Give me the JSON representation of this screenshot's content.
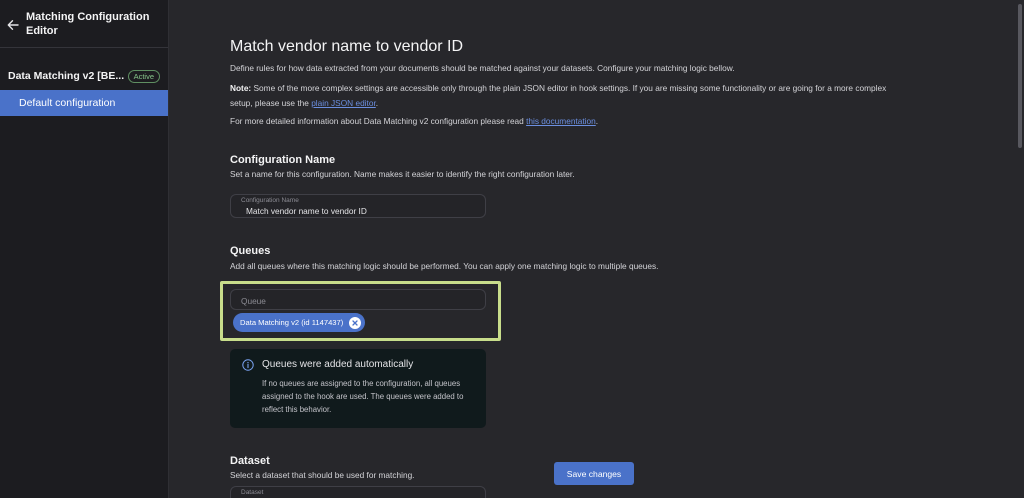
{
  "sidebar": {
    "title": "Matching Configuration Editor",
    "group_name": "Data Matching v2 [BE...",
    "badge": "Active",
    "items": [
      {
        "label": "Default configuration"
      }
    ]
  },
  "main": {
    "title": "Match vendor name to vendor ID",
    "intro": "Define rules for how data extracted from your documents should be matched against your datasets. Configure your matching logic bellow.",
    "note_label": "Note:",
    "note_text_line1": "Some of the more complex settings are accessible only through the plain JSON editor in hook settings. If you are missing some functionality or are going for a more complex",
    "note_text_line2_pre": "setup, please use the ",
    "note_link": "plain JSON editor",
    "note_text_line2_post": ".",
    "doc_pre": "For more detailed information about Data Matching v2 configuration please read ",
    "doc_link": "this documentation",
    "doc_post": "."
  },
  "config_name": {
    "title": "Configuration Name",
    "desc": "Set a name for this configuration. Name makes it easier to identify the right configuration later.",
    "field_label": "Configuration Name",
    "field_value": "Match vendor name to vendor ID"
  },
  "queues": {
    "title": "Queues",
    "desc": "Add all queues where this matching logic should be performed. You can apply one matching logic to multiple queues.",
    "placeholder": "Queue",
    "chip": "Data Matching v2 (id 1147437)",
    "info_title": "Queues were added automatically",
    "info_body": "If no queues are assigned to the configuration, all queues assigned to the hook are used. The queues were added to reflect this behavior."
  },
  "dataset": {
    "title": "Dataset",
    "desc": "Select a dataset that should be used for matching.",
    "field_label": "Dataset"
  },
  "actions": {
    "save_label": "Save changes"
  },
  "colors": {
    "accent": "#4a72c9",
    "highlight": "#c8dd8b",
    "sidebar_bg": "#1c1c20",
    "main_bg": "#27272b"
  },
  "icons": {
    "back": "arrow-left-icon",
    "info": "info-icon",
    "remove": "close-circle-icon"
  }
}
